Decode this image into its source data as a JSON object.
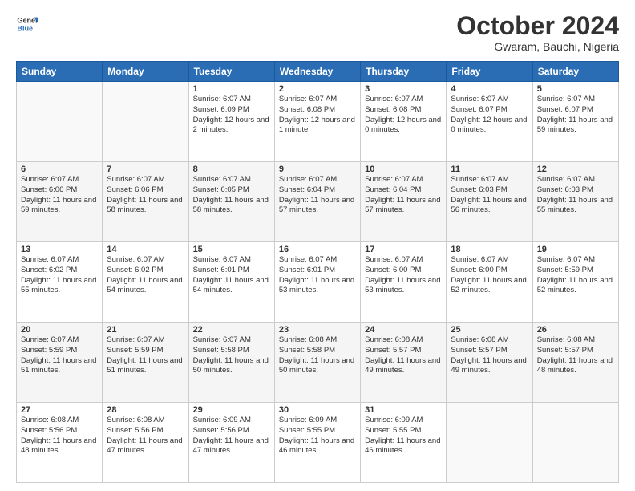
{
  "header": {
    "logo_line1": "General",
    "logo_line2": "Blue",
    "month_title": "October 2024",
    "subtitle": "Gwaram, Bauchi, Nigeria"
  },
  "days_of_week": [
    "Sunday",
    "Monday",
    "Tuesday",
    "Wednesday",
    "Thursday",
    "Friday",
    "Saturday"
  ],
  "weeks": [
    [
      {
        "day": "",
        "content": ""
      },
      {
        "day": "",
        "content": ""
      },
      {
        "day": "1",
        "content": "Sunrise: 6:07 AM\nSunset: 6:09 PM\nDaylight: 12 hours and 2 minutes."
      },
      {
        "day": "2",
        "content": "Sunrise: 6:07 AM\nSunset: 6:08 PM\nDaylight: 12 hours and 1 minute."
      },
      {
        "day": "3",
        "content": "Sunrise: 6:07 AM\nSunset: 6:08 PM\nDaylight: 12 hours and 0 minutes."
      },
      {
        "day": "4",
        "content": "Sunrise: 6:07 AM\nSunset: 6:07 PM\nDaylight: 12 hours and 0 minutes."
      },
      {
        "day": "5",
        "content": "Sunrise: 6:07 AM\nSunset: 6:07 PM\nDaylight: 11 hours and 59 minutes."
      }
    ],
    [
      {
        "day": "6",
        "content": "Sunrise: 6:07 AM\nSunset: 6:06 PM\nDaylight: 11 hours and 59 minutes."
      },
      {
        "day": "7",
        "content": "Sunrise: 6:07 AM\nSunset: 6:06 PM\nDaylight: 11 hours and 58 minutes."
      },
      {
        "day": "8",
        "content": "Sunrise: 6:07 AM\nSunset: 6:05 PM\nDaylight: 11 hours and 58 minutes."
      },
      {
        "day": "9",
        "content": "Sunrise: 6:07 AM\nSunset: 6:04 PM\nDaylight: 11 hours and 57 minutes."
      },
      {
        "day": "10",
        "content": "Sunrise: 6:07 AM\nSunset: 6:04 PM\nDaylight: 11 hours and 57 minutes."
      },
      {
        "day": "11",
        "content": "Sunrise: 6:07 AM\nSunset: 6:03 PM\nDaylight: 11 hours and 56 minutes."
      },
      {
        "day": "12",
        "content": "Sunrise: 6:07 AM\nSunset: 6:03 PM\nDaylight: 11 hours and 55 minutes."
      }
    ],
    [
      {
        "day": "13",
        "content": "Sunrise: 6:07 AM\nSunset: 6:02 PM\nDaylight: 11 hours and 55 minutes."
      },
      {
        "day": "14",
        "content": "Sunrise: 6:07 AM\nSunset: 6:02 PM\nDaylight: 11 hours and 54 minutes."
      },
      {
        "day": "15",
        "content": "Sunrise: 6:07 AM\nSunset: 6:01 PM\nDaylight: 11 hours and 54 minutes."
      },
      {
        "day": "16",
        "content": "Sunrise: 6:07 AM\nSunset: 6:01 PM\nDaylight: 11 hours and 53 minutes."
      },
      {
        "day": "17",
        "content": "Sunrise: 6:07 AM\nSunset: 6:00 PM\nDaylight: 11 hours and 53 minutes."
      },
      {
        "day": "18",
        "content": "Sunrise: 6:07 AM\nSunset: 6:00 PM\nDaylight: 11 hours and 52 minutes."
      },
      {
        "day": "19",
        "content": "Sunrise: 6:07 AM\nSunset: 5:59 PM\nDaylight: 11 hours and 52 minutes."
      }
    ],
    [
      {
        "day": "20",
        "content": "Sunrise: 6:07 AM\nSunset: 5:59 PM\nDaylight: 11 hours and 51 minutes."
      },
      {
        "day": "21",
        "content": "Sunrise: 6:07 AM\nSunset: 5:59 PM\nDaylight: 11 hours and 51 minutes."
      },
      {
        "day": "22",
        "content": "Sunrise: 6:07 AM\nSunset: 5:58 PM\nDaylight: 11 hours and 50 minutes."
      },
      {
        "day": "23",
        "content": "Sunrise: 6:08 AM\nSunset: 5:58 PM\nDaylight: 11 hours and 50 minutes."
      },
      {
        "day": "24",
        "content": "Sunrise: 6:08 AM\nSunset: 5:57 PM\nDaylight: 11 hours and 49 minutes."
      },
      {
        "day": "25",
        "content": "Sunrise: 6:08 AM\nSunset: 5:57 PM\nDaylight: 11 hours and 49 minutes."
      },
      {
        "day": "26",
        "content": "Sunrise: 6:08 AM\nSunset: 5:57 PM\nDaylight: 11 hours and 48 minutes."
      }
    ],
    [
      {
        "day": "27",
        "content": "Sunrise: 6:08 AM\nSunset: 5:56 PM\nDaylight: 11 hours and 48 minutes."
      },
      {
        "day": "28",
        "content": "Sunrise: 6:08 AM\nSunset: 5:56 PM\nDaylight: 11 hours and 47 minutes."
      },
      {
        "day": "29",
        "content": "Sunrise: 6:09 AM\nSunset: 5:56 PM\nDaylight: 11 hours and 47 minutes."
      },
      {
        "day": "30",
        "content": "Sunrise: 6:09 AM\nSunset: 5:55 PM\nDaylight: 11 hours and 46 minutes."
      },
      {
        "day": "31",
        "content": "Sunrise: 6:09 AM\nSunset: 5:55 PM\nDaylight: 11 hours and 46 minutes."
      },
      {
        "day": "",
        "content": ""
      },
      {
        "day": "",
        "content": ""
      }
    ]
  ]
}
